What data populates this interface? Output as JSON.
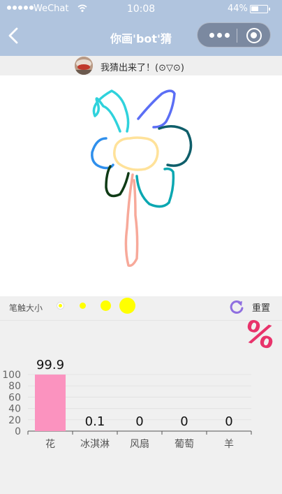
{
  "status": {
    "carrier": "WeChat",
    "time": "10:08",
    "battery": "44%",
    "battery_level": 0.44
  },
  "nav": {
    "title": "你画'bot'猜"
  },
  "message": {
    "text": "我猜出来了！(⊙▽⊙)"
  },
  "brush": {
    "label": "笔触大小",
    "sizes": [
      "small",
      "medium",
      "large",
      "xlarge"
    ],
    "color": "#ffff00"
  },
  "reset": {
    "label": "重置"
  },
  "percent_symbol": "%",
  "colors": {
    "nav_bg": "#b0c4de",
    "bar": "#fb93bf",
    "percent": "#e8336b",
    "reset_icon": "#8f6fe0"
  },
  "chart_data": {
    "type": "bar",
    "categories": [
      "花",
      "冰淇淋",
      "风扇",
      "葡萄",
      "羊"
    ],
    "values": [
      99.9,
      0.1,
      0,
      0,
      0
    ],
    "value_labels": [
      "99.9",
      "0.1",
      "0",
      "0",
      "0"
    ],
    "ylim": [
      0,
      100
    ],
    "yticks": [
      0,
      20,
      40,
      60,
      80,
      100
    ],
    "grid": true
  }
}
